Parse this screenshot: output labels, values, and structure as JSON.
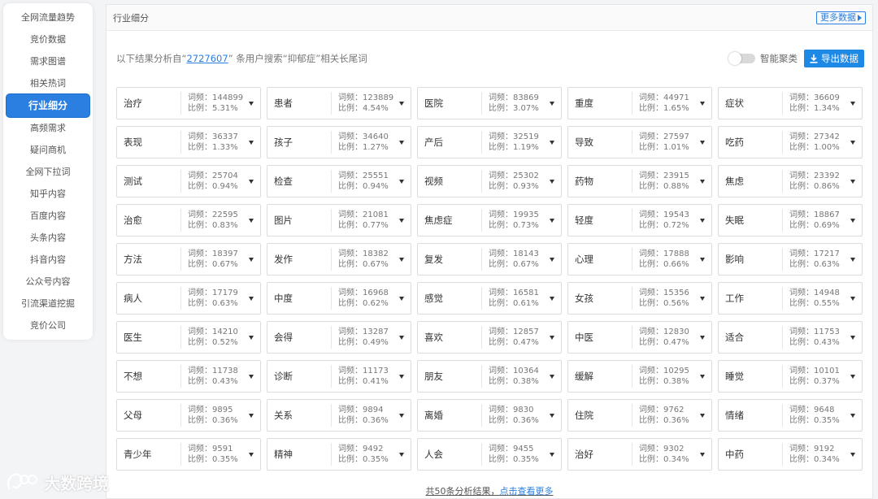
{
  "sidebar": {
    "items": [
      {
        "label": "全网流量趋势",
        "active": false
      },
      {
        "label": "竞价数据",
        "active": false
      },
      {
        "label": "需求图谱",
        "active": false
      },
      {
        "label": "相关热词",
        "active": false
      },
      {
        "label": "行业细分",
        "active": true
      },
      {
        "label": "高频需求",
        "active": false
      },
      {
        "label": "疑问商机",
        "active": false
      },
      {
        "label": "全网下拉词",
        "active": false
      },
      {
        "label": "知乎内容",
        "active": false
      },
      {
        "label": "百度内容",
        "active": false
      },
      {
        "label": "头条内容",
        "active": false
      },
      {
        "label": "抖音内容",
        "active": false
      },
      {
        "label": "公众号内容",
        "active": false
      },
      {
        "label": "引流渠道挖掘",
        "active": false
      },
      {
        "label": "竞价公司",
        "active": false
      }
    ]
  },
  "panel": {
    "title": "行业细分",
    "more_label": "更多数据"
  },
  "summary": {
    "prefix": "以下结果分析自“",
    "count": "2727607",
    "suffix": "” 条用户搜索“抑郁症”相关长尾词"
  },
  "tools": {
    "toggle_label": "智能聚类",
    "export_label": "导出数据"
  },
  "stats_labels": {
    "freq": "词频：",
    "ratio": "比例："
  },
  "words": [
    {
      "word": "治疗",
      "freq": "144899",
      "ratio": "5.31%"
    },
    {
      "word": "患者",
      "freq": "123889",
      "ratio": "4.54%"
    },
    {
      "word": "医院",
      "freq": "83869",
      "ratio": "3.07%"
    },
    {
      "word": "重度",
      "freq": "44971",
      "ratio": "1.65%"
    },
    {
      "word": "症状",
      "freq": "36609",
      "ratio": "1.34%"
    },
    {
      "word": "表现",
      "freq": "36337",
      "ratio": "1.33%"
    },
    {
      "word": "孩子",
      "freq": "34640",
      "ratio": "1.27%"
    },
    {
      "word": "产后",
      "freq": "32519",
      "ratio": "1.19%"
    },
    {
      "word": "导致",
      "freq": "27597",
      "ratio": "1.01%"
    },
    {
      "word": "吃药",
      "freq": "27342",
      "ratio": "1.00%"
    },
    {
      "word": "测试",
      "freq": "25704",
      "ratio": "0.94%"
    },
    {
      "word": "检查",
      "freq": "25551",
      "ratio": "0.94%"
    },
    {
      "word": "视频",
      "freq": "25302",
      "ratio": "0.93%"
    },
    {
      "word": "药物",
      "freq": "23915",
      "ratio": "0.88%"
    },
    {
      "word": "焦虑",
      "freq": "23392",
      "ratio": "0.86%"
    },
    {
      "word": "治愈",
      "freq": "22595",
      "ratio": "0.83%"
    },
    {
      "word": "图片",
      "freq": "21081",
      "ratio": "0.77%"
    },
    {
      "word": "焦虑症",
      "freq": "19935",
      "ratio": "0.73%"
    },
    {
      "word": "轻度",
      "freq": "19543",
      "ratio": "0.72%"
    },
    {
      "word": "失眠",
      "freq": "18867",
      "ratio": "0.69%"
    },
    {
      "word": "方法",
      "freq": "18397",
      "ratio": "0.67%"
    },
    {
      "word": "发作",
      "freq": "18382",
      "ratio": "0.67%"
    },
    {
      "word": "复发",
      "freq": "18143",
      "ratio": "0.67%"
    },
    {
      "word": "心理",
      "freq": "17888",
      "ratio": "0.66%"
    },
    {
      "word": "影响",
      "freq": "17217",
      "ratio": "0.63%"
    },
    {
      "word": "病人",
      "freq": "17179",
      "ratio": "0.63%"
    },
    {
      "word": "中度",
      "freq": "16968",
      "ratio": "0.62%"
    },
    {
      "word": "感觉",
      "freq": "16581",
      "ratio": "0.61%"
    },
    {
      "word": "女孩",
      "freq": "15356",
      "ratio": "0.56%"
    },
    {
      "word": "工作",
      "freq": "14948",
      "ratio": "0.55%"
    },
    {
      "word": "医生",
      "freq": "14210",
      "ratio": "0.52%"
    },
    {
      "word": "会得",
      "freq": "13287",
      "ratio": "0.49%"
    },
    {
      "word": "喜欢",
      "freq": "12857",
      "ratio": "0.47%"
    },
    {
      "word": "中医",
      "freq": "12830",
      "ratio": "0.47%"
    },
    {
      "word": "适合",
      "freq": "11753",
      "ratio": "0.43%"
    },
    {
      "word": "不想",
      "freq": "11738",
      "ratio": "0.43%"
    },
    {
      "word": "诊断",
      "freq": "11173",
      "ratio": "0.41%"
    },
    {
      "word": "朋友",
      "freq": "10364",
      "ratio": "0.38%"
    },
    {
      "word": "缓解",
      "freq": "10295",
      "ratio": "0.38%"
    },
    {
      "word": "睡觉",
      "freq": "10101",
      "ratio": "0.37%"
    },
    {
      "word": "父母",
      "freq": "9895",
      "ratio": "0.36%"
    },
    {
      "word": "关系",
      "freq": "9894",
      "ratio": "0.36%"
    },
    {
      "word": "离婚",
      "freq": "9830",
      "ratio": "0.36%"
    },
    {
      "word": "住院",
      "freq": "9762",
      "ratio": "0.36%"
    },
    {
      "word": "情绪",
      "freq": "9648",
      "ratio": "0.35%"
    },
    {
      "word": "青少年",
      "freq": "9591",
      "ratio": "0.35%"
    },
    {
      "word": "精神",
      "freq": "9492",
      "ratio": "0.35%"
    },
    {
      "word": "人会",
      "freq": "9455",
      "ratio": "0.35%"
    },
    {
      "word": "治好",
      "freq": "9302",
      "ratio": "0.34%"
    },
    {
      "word": "中药",
      "freq": "9192",
      "ratio": "0.34%"
    }
  ],
  "footer": {
    "prefix": "共50条分析结果，",
    "link": "点击查看更多"
  },
  "watermark": {
    "text": "大数跨境"
  },
  "colors": {
    "accent": "#2a7fe0",
    "export_bg": "#1e88e5"
  }
}
